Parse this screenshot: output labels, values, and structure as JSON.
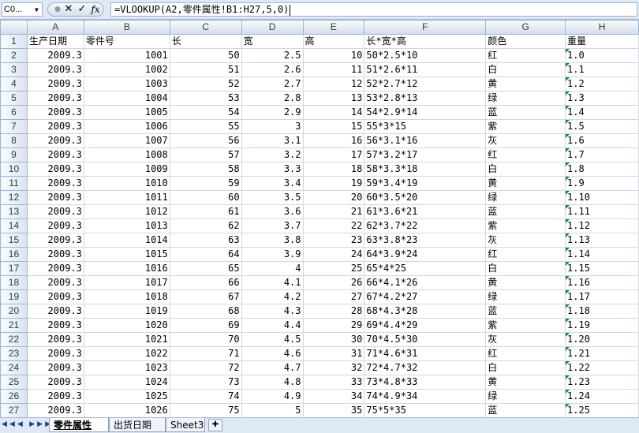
{
  "name_box": "C0...",
  "formula_bar": {
    "cancel_icon": "✕",
    "enter_icon": "✓",
    "fx_label": "fx",
    "formula": "=VLOOKUP(A2,零件属性!B1:H27,5,0)"
  },
  "columns": [
    "A",
    "B",
    "C",
    "D",
    "E",
    "F",
    "G",
    "H"
  ],
  "header_row": {
    "row": "1",
    "cells": [
      "生产日期",
      "零件号",
      "长",
      "宽",
      "高",
      "长*宽*高",
      "颜色",
      "重量"
    ]
  },
  "rows": [
    {
      "row": "2",
      "cells": [
        "2009.3",
        "1001",
        "50",
        "2.5",
        "10",
        "50*2.5*10",
        "红",
        "1.0"
      ]
    },
    {
      "row": "3",
      "cells": [
        "2009.3",
        "1002",
        "51",
        "2.6",
        "11",
        "51*2.6*11",
        "白",
        "1.1"
      ]
    },
    {
      "row": "4",
      "cells": [
        "2009.3",
        "1003",
        "52",
        "2.7",
        "12",
        "52*2.7*12",
        "黄",
        "1.2"
      ]
    },
    {
      "row": "5",
      "cells": [
        "2009.3",
        "1004",
        "53",
        "2.8",
        "13",
        "53*2.8*13",
        "绿",
        "1.3"
      ]
    },
    {
      "row": "6",
      "cells": [
        "2009.3",
        "1005",
        "54",
        "2.9",
        "14",
        "54*2.9*14",
        "蓝",
        "1.4"
      ]
    },
    {
      "row": "7",
      "cells": [
        "2009.3",
        "1006",
        "55",
        "3",
        "15",
        "55*3*15",
        "紫",
        "1.5"
      ]
    },
    {
      "row": "8",
      "cells": [
        "2009.3",
        "1007",
        "56",
        "3.1",
        "16",
        "56*3.1*16",
        "灰",
        "1.6"
      ]
    },
    {
      "row": "9",
      "cells": [
        "2009.3",
        "1008",
        "57",
        "3.2",
        "17",
        "57*3.2*17",
        "红",
        "1.7"
      ]
    },
    {
      "row": "10",
      "cells": [
        "2009.3",
        "1009",
        "58",
        "3.3",
        "18",
        "58*3.3*18",
        "白",
        "1.8"
      ]
    },
    {
      "row": "11",
      "cells": [
        "2009.3",
        "1010",
        "59",
        "3.4",
        "19",
        "59*3.4*19",
        "黄",
        "1.9"
      ]
    },
    {
      "row": "12",
      "cells": [
        "2009.3",
        "1011",
        "60",
        "3.5",
        "20",
        "60*3.5*20",
        "绿",
        "1.10"
      ]
    },
    {
      "row": "13",
      "cells": [
        "2009.3",
        "1012",
        "61",
        "3.6",
        "21",
        "61*3.6*21",
        "蓝",
        "1.11"
      ]
    },
    {
      "row": "14",
      "cells": [
        "2009.3",
        "1013",
        "62",
        "3.7",
        "22",
        "62*3.7*22",
        "紫",
        "1.12"
      ]
    },
    {
      "row": "15",
      "cells": [
        "2009.3",
        "1014",
        "63",
        "3.8",
        "23",
        "63*3.8*23",
        "灰",
        "1.13"
      ]
    },
    {
      "row": "16",
      "cells": [
        "2009.3",
        "1015",
        "64",
        "3.9",
        "24",
        "64*3.9*24",
        "红",
        "1.14"
      ]
    },
    {
      "row": "17",
      "cells": [
        "2009.3",
        "1016",
        "65",
        "4",
        "25",
        "65*4*25",
        "白",
        "1.15"
      ]
    },
    {
      "row": "18",
      "cells": [
        "2009.3",
        "1017",
        "66",
        "4.1",
        "26",
        "66*4.1*26",
        "黄",
        "1.16"
      ]
    },
    {
      "row": "19",
      "cells": [
        "2009.3",
        "1018",
        "67",
        "4.2",
        "27",
        "67*4.2*27",
        "绿",
        "1.17"
      ]
    },
    {
      "row": "20",
      "cells": [
        "2009.3",
        "1019",
        "68",
        "4.3",
        "28",
        "68*4.3*28",
        "蓝",
        "1.18"
      ]
    },
    {
      "row": "21",
      "cells": [
        "2009.3",
        "1020",
        "69",
        "4.4",
        "29",
        "69*4.4*29",
        "紫",
        "1.19"
      ]
    },
    {
      "row": "22",
      "cells": [
        "2009.3",
        "1021",
        "70",
        "4.5",
        "30",
        "70*4.5*30",
        "灰",
        "1.20"
      ]
    },
    {
      "row": "23",
      "cells": [
        "2009.3",
        "1022",
        "71",
        "4.6",
        "31",
        "71*4.6*31",
        "红",
        "1.21"
      ]
    },
    {
      "row": "24",
      "cells": [
        "2009.3",
        "1023",
        "72",
        "4.7",
        "32",
        "72*4.7*32",
        "白",
        "1.22"
      ]
    },
    {
      "row": "25",
      "cells": [
        "2009.3",
        "1024",
        "73",
        "4.8",
        "33",
        "73*4.8*33",
        "黄",
        "1.23"
      ]
    },
    {
      "row": "26",
      "cells": [
        "2009.3",
        "1025",
        "74",
        "4.9",
        "34",
        "74*4.9*34",
        "绿",
        "1.24"
      ]
    },
    {
      "row": "27",
      "cells": [
        "2009.3",
        "1026",
        "75",
        "5",
        "35",
        "75*5*35",
        "蓝",
        "1.25"
      ]
    }
  ],
  "sheet_tabs": [
    "零件属性",
    "出货日期",
    "Sheet3"
  ],
  "active_tab": "零件属性",
  "colors": {
    "error_indicator": "#0b8a2e",
    "ribbon_bg": "#dfe8f5",
    "header_bg": "#d3dbe9"
  }
}
